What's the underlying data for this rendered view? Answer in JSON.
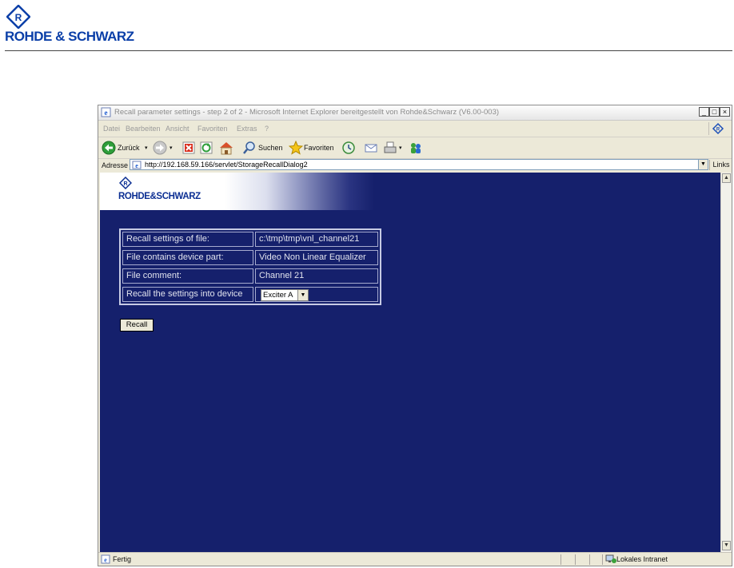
{
  "document": {
    "brand": "ROHDE & SCHWARZ"
  },
  "window": {
    "title": "Recall parameter settings - step 2 of 2 - Microsoft Internet Explorer bereitgestellt von Rohde&Schwarz (V6.00-003)",
    "minimize": "_",
    "maximize": "□",
    "close": "×"
  },
  "menu": {
    "items": [
      "Datei",
      "Bearbeiten",
      "Ansicht",
      "Favoriten",
      "Extras",
      "?"
    ]
  },
  "toolbar": {
    "back_label": "Zurück",
    "search_label": "Suchen",
    "favorites_label": "Favoriten"
  },
  "address": {
    "label": "Adresse",
    "url": "http://192.168.59.166/servlet/StorageRecallDialog2",
    "links_label": "Links"
  },
  "banner": {
    "brand": "ROHDE&SCHWARZ"
  },
  "recall_table": {
    "rows": [
      {
        "label": "Recall settings of file:",
        "value": "c:\\tmp\\tmp\\vnl_channel21"
      },
      {
        "label": "File contains device part:",
        "value": "Video Non Linear Equalizer"
      },
      {
        "label": "File comment:",
        "value": "Channel 21"
      },
      {
        "label": "Recall the settings into device",
        "value": "Exciter A"
      }
    ]
  },
  "recall_button": "Recall",
  "status": {
    "text": "Fertig",
    "zone": "Lokales Intranet"
  },
  "colors": {
    "content_background": "#15206c",
    "brand_blue": "#0b3fa8"
  }
}
